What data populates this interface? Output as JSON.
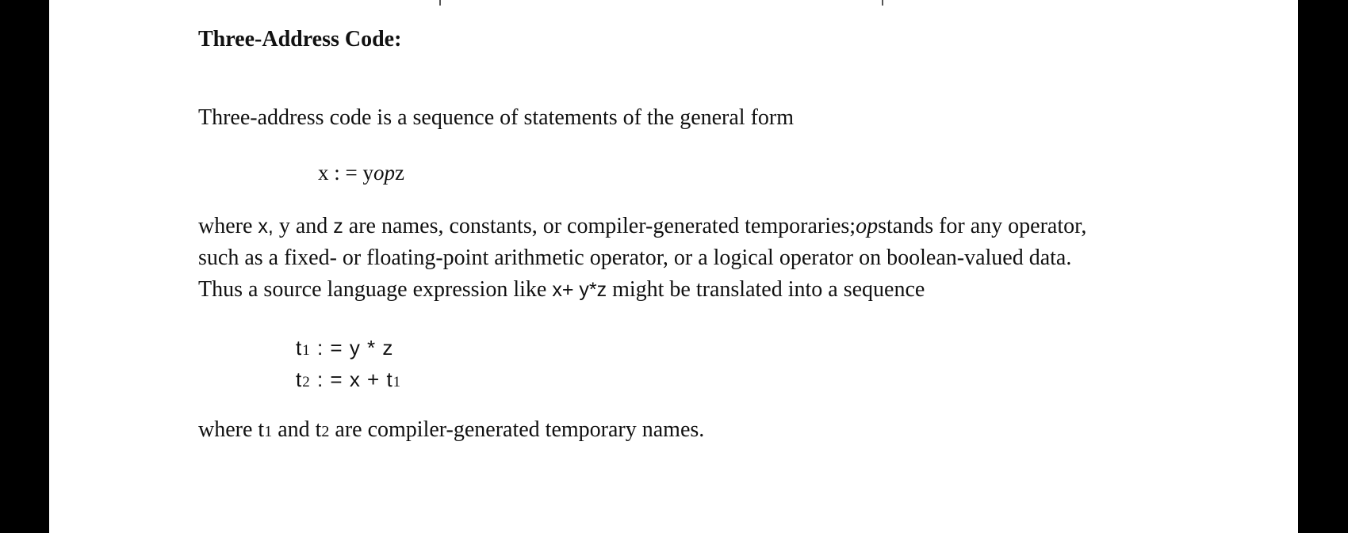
{
  "document": {
    "heading": "Three-Address Code:",
    "intro": "Three-address code is a sequence of statements of the general form",
    "formula": {
      "lhs": "x : = ",
      "rhs_prefix": "y",
      "rhs_op": "op",
      "rhs_suffix": "z"
    },
    "paragraph": {
      "part1": "where ",
      "var_x": "x,",
      "part2": " y and ",
      "var_z": "z",
      "part3": " are names, constants, or compiler-generated temporaries;",
      "op_word": "op",
      "part4": "stands for any operator, such as a fixed- or floating-point arithmetic operator, or a logical operator on boolean-valued data. Thus a source language expression like ",
      "expr": "x+ y*z",
      "part5": "  might be translated into a sequence"
    },
    "code": [
      {
        "lhs_base": "t",
        "lhs_sub": "1",
        "rest": " : = y  *  z"
      },
      {
        "lhs_base": "t",
        "lhs_sub": "2",
        "rest": " : = x  +  t",
        "rest_sub": "1"
      }
    ],
    "outro": {
      "part1": "where t",
      "sub1": "1",
      "part2": " and t",
      "sub2": "2",
      "part3": " are compiler-generated temporary names."
    }
  }
}
